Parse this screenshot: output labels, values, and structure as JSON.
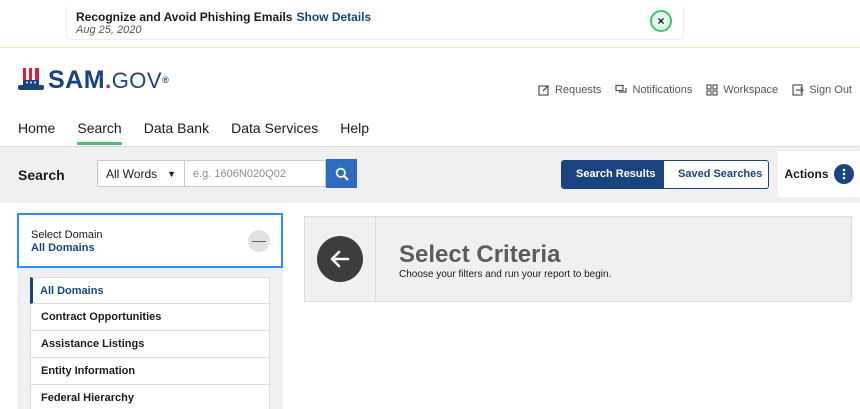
{
  "alert": {
    "title": "Recognize and Avoid Phishing Emails",
    "link": "Show Details",
    "date": "Aug 25, 2020",
    "close_symbol": "×"
  },
  "brand": {
    "name_main": "SAM",
    "name_dot": ".",
    "name_suffix": "GOV",
    "registered": "®",
    "hat_icon": "uncle-sam-hat-icon"
  },
  "top_links": [
    {
      "label": "Requests",
      "icon": "edit-icon"
    },
    {
      "label": "Notifications",
      "icon": "chat-icon"
    },
    {
      "label": "Workspace",
      "icon": "grid-icon"
    },
    {
      "label": "Sign Out",
      "icon": "sign-out-icon"
    }
  ],
  "main_nav": [
    {
      "label": "Home",
      "active": false
    },
    {
      "label": "Search",
      "active": true
    },
    {
      "label": "Data Bank",
      "active": false
    },
    {
      "label": "Data Services",
      "active": false
    },
    {
      "label": "Help",
      "active": false
    }
  ],
  "search": {
    "label": "Search",
    "select_value": "All Words",
    "placeholder": "e.g. 1606N020Q02",
    "value": ""
  },
  "result_tabs": {
    "results": "Search Results",
    "saved": "Saved Searches"
  },
  "actions": {
    "label": "Actions"
  },
  "domain": {
    "label": "Select Domain",
    "value": "All Domains",
    "toggle_symbol": "—",
    "options": [
      "All Domains",
      "Contract Opportunities",
      "Assistance Listings",
      "Entity Information",
      "Federal Hierarchy"
    ],
    "selected_index": 0
  },
  "criteria": {
    "title": "Select Criteria",
    "subtitle": "Choose your filters and run your report to begin."
  },
  "colors": {
    "primary": "#1a4480",
    "accent_green": "#4fbf78",
    "search_button": "#2e6bbf",
    "focus_border": "#2491ff",
    "logo_red": "#e31c3d"
  }
}
